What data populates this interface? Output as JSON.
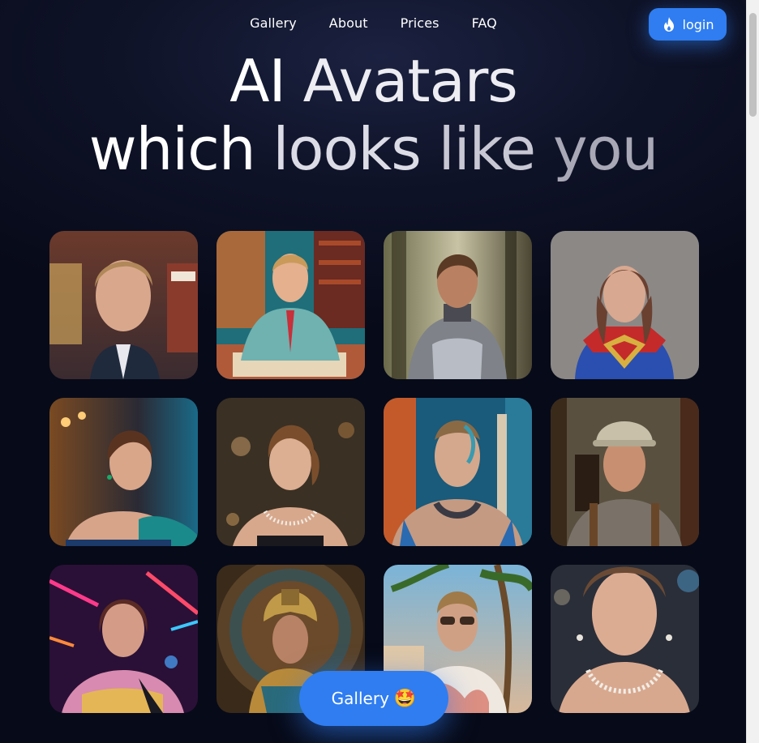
{
  "nav": {
    "links": [
      "Gallery",
      "About",
      "Prices",
      "FAQ"
    ],
    "login_label": "login"
  },
  "hero": {
    "line1": [
      "AI",
      "Avatars"
    ],
    "line2": [
      "which",
      "looks",
      "like",
      "you"
    ]
  },
  "gallery": {
    "tiles": [
      "man-selfie-portrait",
      "man-in-suit-at-desk-painting",
      "woman-in-armor-portrait",
      "woman-in-superhero-costume",
      "woman-in-teal-dress-portrait",
      "woman-with-pearl-necklace-portrait",
      "man-with-tattoos-portrait",
      "man-in-hard-hat-portrait",
      "woman-with-neon-lights-portrait",
      "man-with-ornate-headdress",
      "man-in-sunglasses-palm-trees",
      "woman-with-pearl-necklace-closeup"
    ]
  },
  "cta": {
    "label": "Gallery",
    "emoji": "🤩"
  },
  "colors": {
    "accent": "#2f7df1",
    "background": "#070a18"
  }
}
